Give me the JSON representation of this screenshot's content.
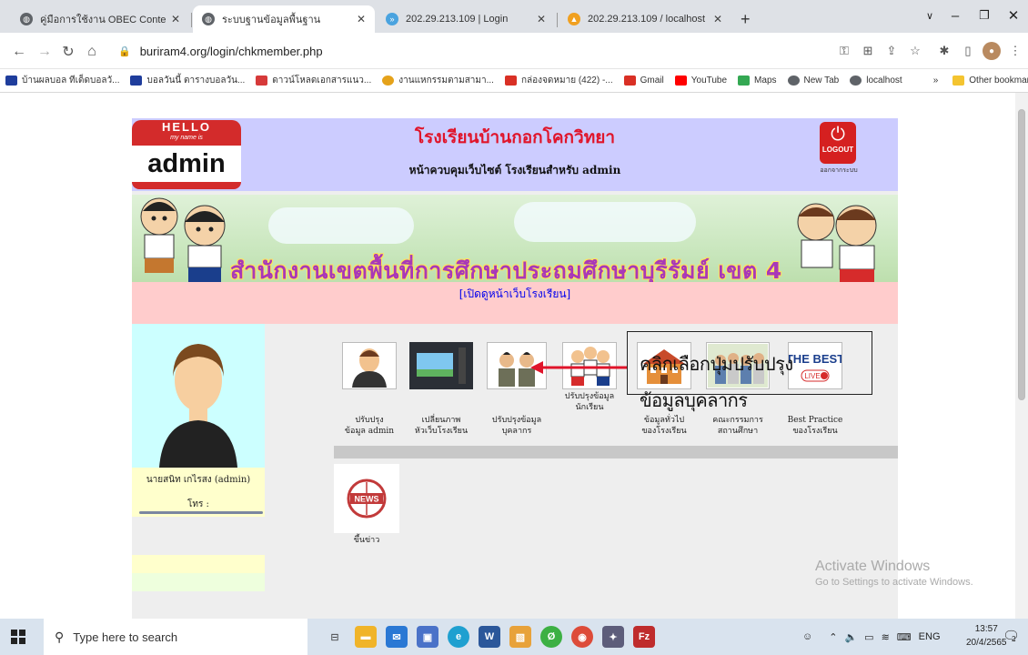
{
  "browser": {
    "tabs": [
      {
        "title": "คู่มือการใช้งาน OBEC Content Cente",
        "active": false,
        "icon": "globe-icon"
      },
      {
        "title": "ระบบฐานข้อมูลพื้นฐาน",
        "active": true,
        "icon": "globe-icon"
      },
      {
        "title": "202.29.213.109 | Login",
        "active": false,
        "icon": "phpmyadmin-icon"
      },
      {
        "title": "202.29.213.109 / localhost / burir",
        "active": false,
        "icon": "phpmyadmin-icon"
      }
    ],
    "new_tab": "+",
    "url": "buriram4.org/login/chkmember.php",
    "bookmarks": [
      {
        "label": "บ้านผลบอล ทีเด็ดบอลวั...",
        "color": "#1f3d9c"
      },
      {
        "label": "บอลวันนี้ ตารางบอลวัน...",
        "color": "#1f3d9c"
      },
      {
        "label": "ดาวน์โหลดเอกสารแนว...",
        "color": "#d63a3a"
      },
      {
        "label": "งานแหกรรมตามสามา...",
        "color": "#e5a21a"
      },
      {
        "label": "กล่องจดหมาย (422) -...",
        "color": "#d93025"
      },
      {
        "label": "Gmail",
        "color": "#d93025"
      },
      {
        "label": "YouTube",
        "color": "#ff0000"
      },
      {
        "label": "Maps",
        "color": "#34a853"
      },
      {
        "label": "New Tab",
        "color": "#5f6368"
      },
      {
        "label": "localhost",
        "color": "#5f6368"
      }
    ],
    "bookmarks_more": "»",
    "other_bookmarks": "Other bookmarks"
  },
  "site": {
    "hello": {
      "top": "HELLO",
      "sub": "my name is",
      "name": "admin"
    },
    "school_name": "โรงเรียนบ้านกอกโคกวิทยา",
    "school_sub": "หน้าควบคุมเว็บไซต์ โรงเรียนสำหรับ admin",
    "logout": {
      "label": "LOGOUT",
      "thai": "ออกจากระบบ"
    },
    "banner_text": "สำนักงานเขตพื้นที่การศึกษาประถมศึกษาบุรีรัมย์ เขต 4",
    "view_link": "[เปิดดูหน้าเว็บโรงเรียน]",
    "user_name": "นายสนิท เกไรสง (admin)",
    "user_phone": "โทร :",
    "menu": [
      {
        "label": "ปรับปรุง",
        "label2": "ข้อมูล admin",
        "icon": "admin-profile-icon"
      },
      {
        "label": "เปลี่ยนภาพ",
        "label2": "หัวเว็บโรงเรียน",
        "icon": "banner-image-icon"
      },
      {
        "label": "ปรับปรุงข้อมูล",
        "label2": "บุคลากร",
        "icon": "personnel-icon"
      },
      {
        "label": "ปรับปรุงข้อมูล",
        "label2": "นักเรียน",
        "icon": "students-icon"
      },
      {
        "label": "ข้อมูลทั่วไป",
        "label2": "ของโรงเรียน",
        "icon": "school-building-icon"
      },
      {
        "label": "คณะกรรมการ",
        "label2": "สถานศึกษา",
        "icon": "committee-icon"
      },
      {
        "label": "Best Practice",
        "label2": "ของโรงเรียน",
        "icon": "best-practice-icon"
      },
      {
        "label": "ขึ้นข่าว",
        "label2": "",
        "icon": "news-icon"
      }
    ],
    "callout_line1": "คลิกเลือกปุ่มปรับปรุง",
    "callout_line2": "ข้อมูลบุคลากร",
    "best_text": "THE BEST",
    "live_text": "LIVE",
    "news_text": "NEWS"
  },
  "watermark": {
    "line1": "Activate Windows",
    "line2": "Go to Settings to activate Windows."
  },
  "taskbar": {
    "search_placeholder": "Type here to search",
    "lang": "ENG",
    "time": "13:57",
    "date": "20/4/2565",
    "notif_count": "2"
  }
}
